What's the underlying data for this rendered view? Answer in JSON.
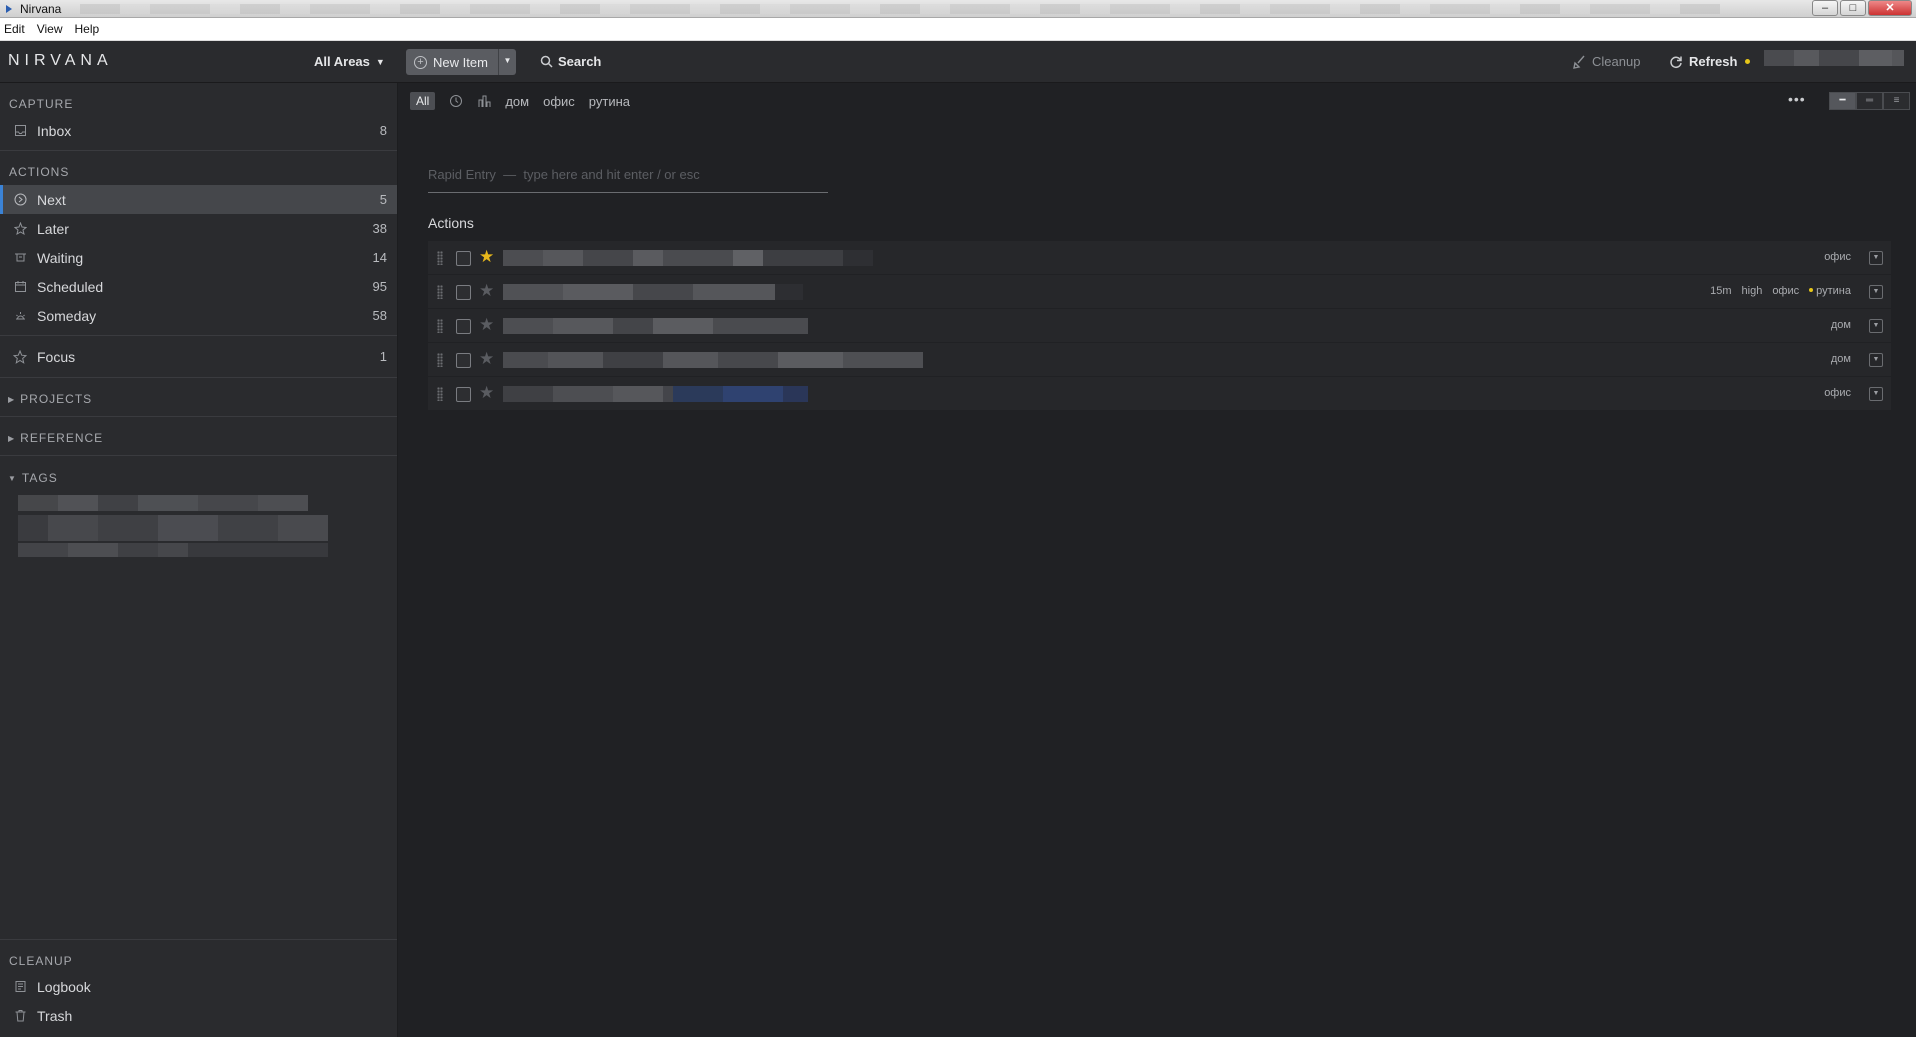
{
  "window": {
    "title": "Nirvana",
    "buttons": {
      "minimize": "–",
      "maximize": "□",
      "close": "✕"
    }
  },
  "menu": [
    "Edit",
    "View",
    "Help"
  ],
  "header": {
    "logo": "NIRVANA",
    "areas_label": "All Areas",
    "new_item_label": "New Item",
    "search_label": "Search",
    "cleanup_label": "Cleanup",
    "refresh_label": "Refresh",
    "status_dot_color": "#e6c619"
  },
  "sidebar": {
    "capture_title": "CAPTURE",
    "inbox": {
      "label": "Inbox",
      "count": "8"
    },
    "actions_title": "ACTIONS",
    "actions": [
      {
        "label": "Next",
        "count": "5",
        "icon": "next-icon",
        "active": true
      },
      {
        "label": "Later",
        "count": "38",
        "icon": "later-icon"
      },
      {
        "label": "Waiting",
        "count": "14",
        "icon": "waiting-icon"
      },
      {
        "label": "Scheduled",
        "count": "95",
        "icon": "calendar-icon"
      },
      {
        "label": "Someday",
        "count": "58",
        "icon": "someday-icon"
      }
    ],
    "focus": {
      "label": "Focus",
      "count": "1"
    },
    "projects_title": "PROJECTS",
    "reference_title": "REFERENCE",
    "tags_title": "TAGS",
    "cleanup_title": "CLEANUP",
    "logbook_label": "Logbook",
    "trash_label": "Trash"
  },
  "filters": {
    "all_label": "All",
    "tags": [
      "дом",
      "офис",
      "рутина"
    ]
  },
  "rapid_entry": {
    "placeholder": "Rapid Entry  —  type here and hit enter / or esc"
  },
  "actions_heading": "Actions",
  "tasks": [
    {
      "starred": true,
      "meta": {
        "tags": "офис"
      }
    },
    {
      "starred": false,
      "meta": {
        "time": "15m",
        "energy": "high",
        "tags": "офис",
        "extra_tag": "рутина"
      }
    },
    {
      "starred": false,
      "meta": {
        "tags": "дом"
      }
    },
    {
      "starred": false,
      "meta": {
        "tags": "дом"
      }
    },
    {
      "starred": false,
      "meta": {
        "tags": "офис"
      }
    }
  ],
  "colors": {
    "accent": "#3b83d6",
    "star": "#e8b81b",
    "background": "#202124",
    "sidebar": "#2a2b2e"
  }
}
